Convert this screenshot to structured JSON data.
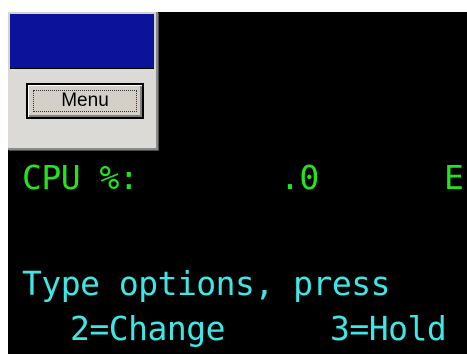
{
  "menu_window": {
    "button_label": "Menu"
  },
  "terminal": {
    "cpu_label": "CPU %:",
    "cpu_value": ".0",
    "cpu_trailing": "E",
    "instruction": "Type options, press",
    "option_change": "2=Change",
    "option_hold": "3=Hold"
  },
  "colors": {
    "background": "#000000",
    "field_text": "#22e61c",
    "prompt_text": "#3fe6e6",
    "titlebar": "#0d129a",
    "window_face": "#d4d0c8"
  }
}
